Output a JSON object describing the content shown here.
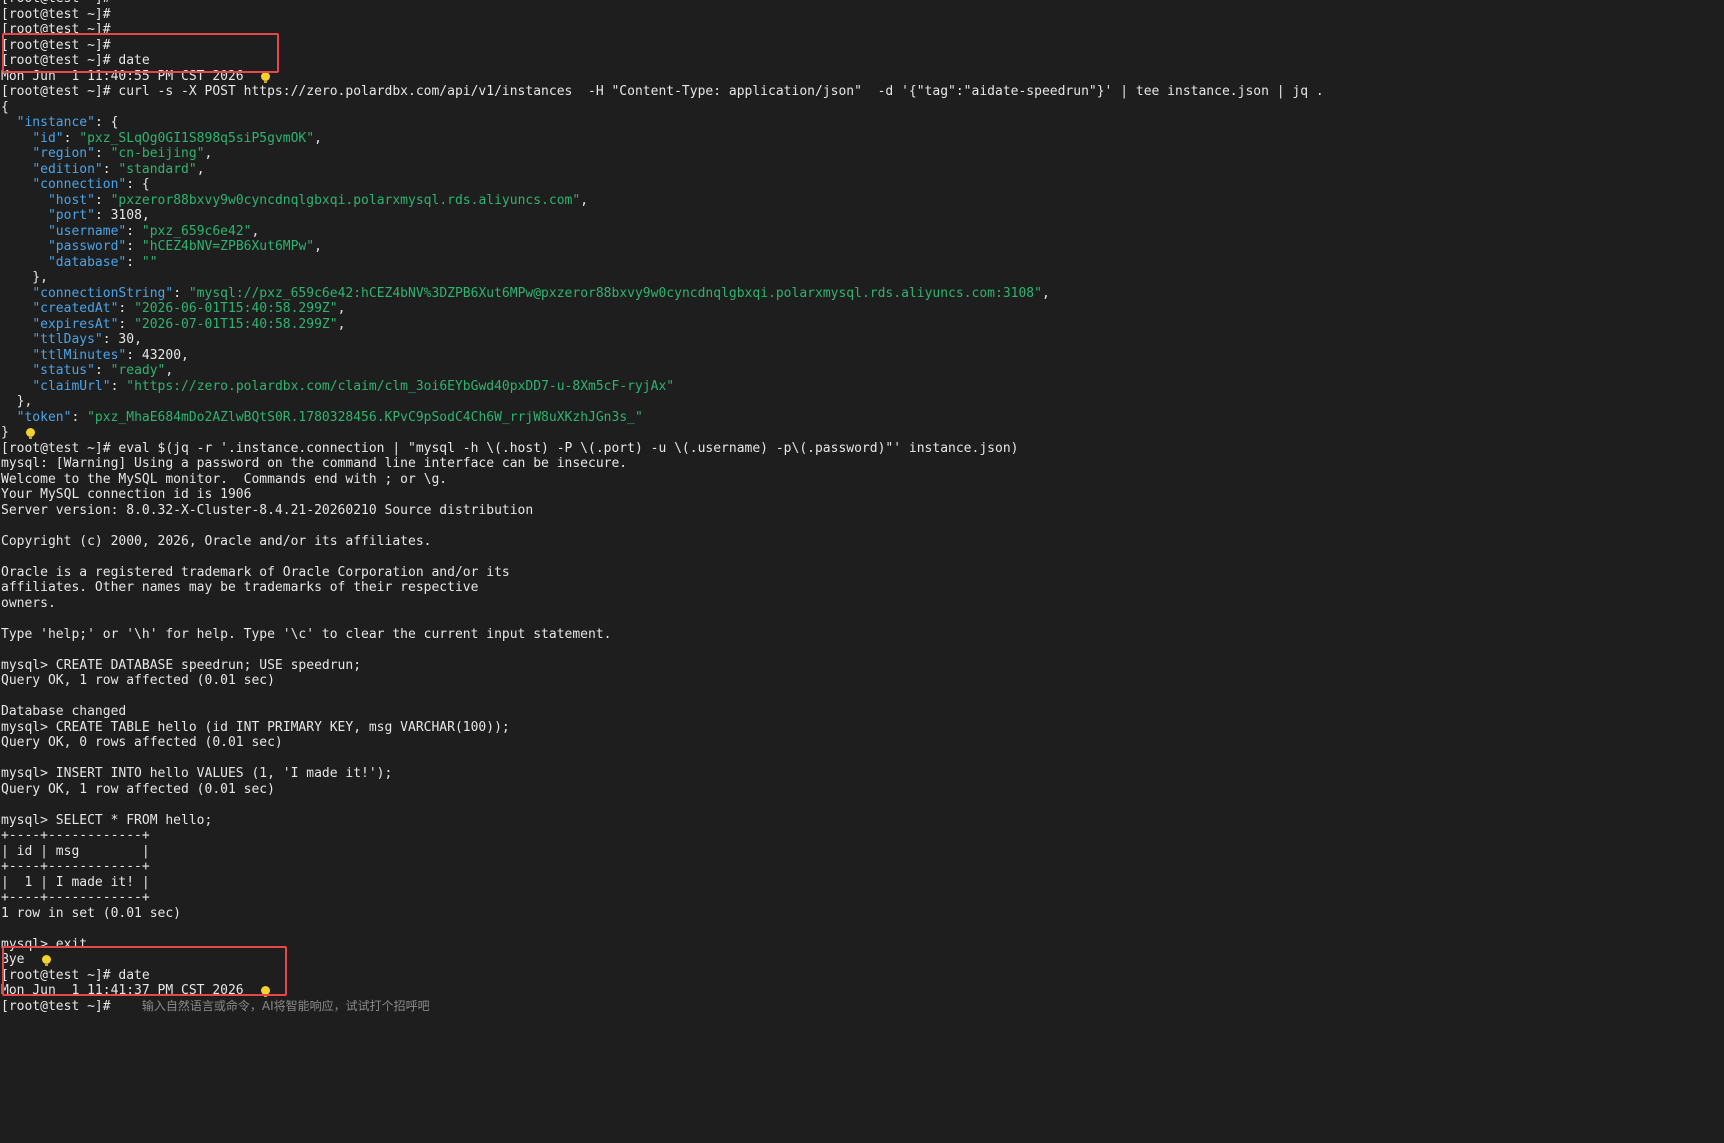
{
  "terminal": {
    "lines": [
      {
        "t": "[root@test ~]#"
      },
      {
        "t": "[root@test ~]#"
      },
      {
        "t": "[root@test ~]#"
      },
      {
        "t": "[root@test ~]#"
      },
      {
        "t": "[root@test ~]# date"
      },
      {
        "t": "Mon Jun  1 11:40:55 PM CST 2026  ",
        "bulb": true
      },
      {
        "t": "[root@test ~]# curl -s -X POST https://zero.polardbx.com/api/v1/instances  -H \"Content-Type: application/json\"  -d '{\"tag\":\"aidate-speedrun\"}' | tee instance.json | jq ."
      },
      {
        "t": "{"
      },
      {
        "indent": "  ",
        "key": "\"instance\"",
        "rest": ": {"
      },
      {
        "indent": "    ",
        "key": "\"id\"",
        "sep": ": ",
        "str": "\"pxz_SLqOg0GI1S898q5siP5gvmOK\"",
        "rest": ","
      },
      {
        "indent": "    ",
        "key": "\"region\"",
        "sep": ": ",
        "str": "\"cn-beijing\"",
        "rest": ","
      },
      {
        "indent": "    ",
        "key": "\"edition\"",
        "sep": ": ",
        "str": "\"standard\"",
        "rest": ","
      },
      {
        "indent": "    ",
        "key": "\"connection\"",
        "rest": ": {"
      },
      {
        "indent": "      ",
        "key": "\"host\"",
        "sep": ": ",
        "str": "\"pxzeror88bxvy9w0cyncdnqlgbxqi.polarxmysql.rds.aliyuncs.com\"",
        "rest": ","
      },
      {
        "indent": "      ",
        "key": "\"port\"",
        "rest": ": 3108,"
      },
      {
        "indent": "      ",
        "key": "\"username\"",
        "sep": ": ",
        "str": "\"pxz_659c6e42\"",
        "rest": ","
      },
      {
        "indent": "      ",
        "key": "\"password\"",
        "sep": ": ",
        "str": "\"hCEZ4bNV=ZPB6Xut6MPw\"",
        "rest": ","
      },
      {
        "indent": "      ",
        "key": "\"database\"",
        "sep": ": ",
        "str": "\"\""
      },
      {
        "t": "    },"
      },
      {
        "indent": "    ",
        "key": "\"connectionString\"",
        "sep": ": ",
        "str": "\"mysql://pxz_659c6e42:hCEZ4bNV%3DZPB6Xut6MPw@pxzeror88bxvy9w0cyncdnqlgbxqi.polarxmysql.rds.aliyuncs.com:3108\"",
        "rest": ","
      },
      {
        "indent": "    ",
        "key": "\"createdAt\"",
        "sep": ": ",
        "str": "\"2026-06-01T15:40:58.299Z\"",
        "rest": ","
      },
      {
        "indent": "    ",
        "key": "\"expiresAt\"",
        "sep": ": ",
        "str": "\"2026-07-01T15:40:58.299Z\"",
        "rest": ","
      },
      {
        "indent": "    ",
        "key": "\"ttlDays\"",
        "rest": ": 30,"
      },
      {
        "indent": "    ",
        "key": "\"ttlMinutes\"",
        "rest": ": 43200,"
      },
      {
        "indent": "    ",
        "key": "\"status\"",
        "sep": ": ",
        "str": "\"ready\"",
        "rest": ","
      },
      {
        "indent": "    ",
        "key": "\"claimUrl\"",
        "sep": ": ",
        "str": "\"https://zero.polardbx.com/claim/clm_3oi6EYbGwd40pxDD7-u-8Xm5cF-ryjAx\""
      },
      {
        "t": "  },"
      },
      {
        "indent": "  ",
        "key": "\"token\"",
        "sep": ": ",
        "str": "\"pxz_MhaE684mDo2AZlwBQtS0R.1780328456.KPvC9pSodC4Ch6W_rrjW8uXKzhJGn3s_\""
      },
      {
        "t": "}  ",
        "bulb": true
      },
      {
        "t": "[root@test ~]# eval $(jq -r '.instance.connection | \"mysql -h \\(.host) -P \\(.port) -u \\(.username) -p\\(.password)\"' instance.json)"
      },
      {
        "t": "mysql: [Warning] Using a password on the command line interface can be insecure."
      },
      {
        "t": "Welcome to the MySQL monitor.  Commands end with ; or \\g."
      },
      {
        "t": "Your MySQL connection id is 1906"
      },
      {
        "t": "Server version: 8.0.32-X-Cluster-8.4.21-20260210 Source distribution"
      },
      {
        "t": ""
      },
      {
        "t": "Copyright (c) 2000, 2026, Oracle and/or its affiliates."
      },
      {
        "t": ""
      },
      {
        "t": "Oracle is a registered trademark of Oracle Corporation and/or its"
      },
      {
        "t": "affiliates. Other names may be trademarks of their respective"
      },
      {
        "t": "owners."
      },
      {
        "t": ""
      },
      {
        "t": "Type 'help;' or '\\h' for help. Type '\\c' to clear the current input statement."
      },
      {
        "t": ""
      },
      {
        "t": "mysql> CREATE DATABASE speedrun; USE speedrun;"
      },
      {
        "t": "Query OK, 1 row affected (0.01 sec)"
      },
      {
        "t": ""
      },
      {
        "t": "Database changed"
      },
      {
        "t": "mysql> CREATE TABLE hello (id INT PRIMARY KEY, msg VARCHAR(100));"
      },
      {
        "t": "Query OK, 0 rows affected (0.01 sec)"
      },
      {
        "t": ""
      },
      {
        "t": "mysql> INSERT INTO hello VALUES (1, 'I made it!');"
      },
      {
        "t": "Query OK, 1 row affected (0.01 sec)"
      },
      {
        "t": ""
      },
      {
        "t": "mysql> SELECT * FROM hello;"
      },
      {
        "t": "+----+------------+"
      },
      {
        "t": "| id | msg        |"
      },
      {
        "t": "+----+------------+"
      },
      {
        "t": "|  1 | I made it! |"
      },
      {
        "t": "+----+------------+"
      },
      {
        "t": "1 row in set (0.01 sec)"
      },
      {
        "t": ""
      },
      {
        "t": "mysql> exit"
      },
      {
        "t": "Bye  ",
        "bulb": true
      },
      {
        "t": "[root@test ~]# date"
      },
      {
        "t": "Mon Jun  1 11:41:37 PM CST 2026  ",
        "bulb": true
      },
      {
        "t": "[root@test ~]#    ",
        "hint": "输入自然语言或命令，AI将智能响应，试试打个招呼吧"
      }
    ]
  },
  "colors": {
    "background": "#1e1e1e",
    "text": "#e6e6e6",
    "json_key": "#4ba3e8",
    "json_string": "#2fb36e",
    "highlight_border": "#e8474a",
    "hint": "#8a8a8a",
    "bulb": "#f2d22e"
  },
  "icons": {
    "bulb": "lightbulb-icon"
  }
}
